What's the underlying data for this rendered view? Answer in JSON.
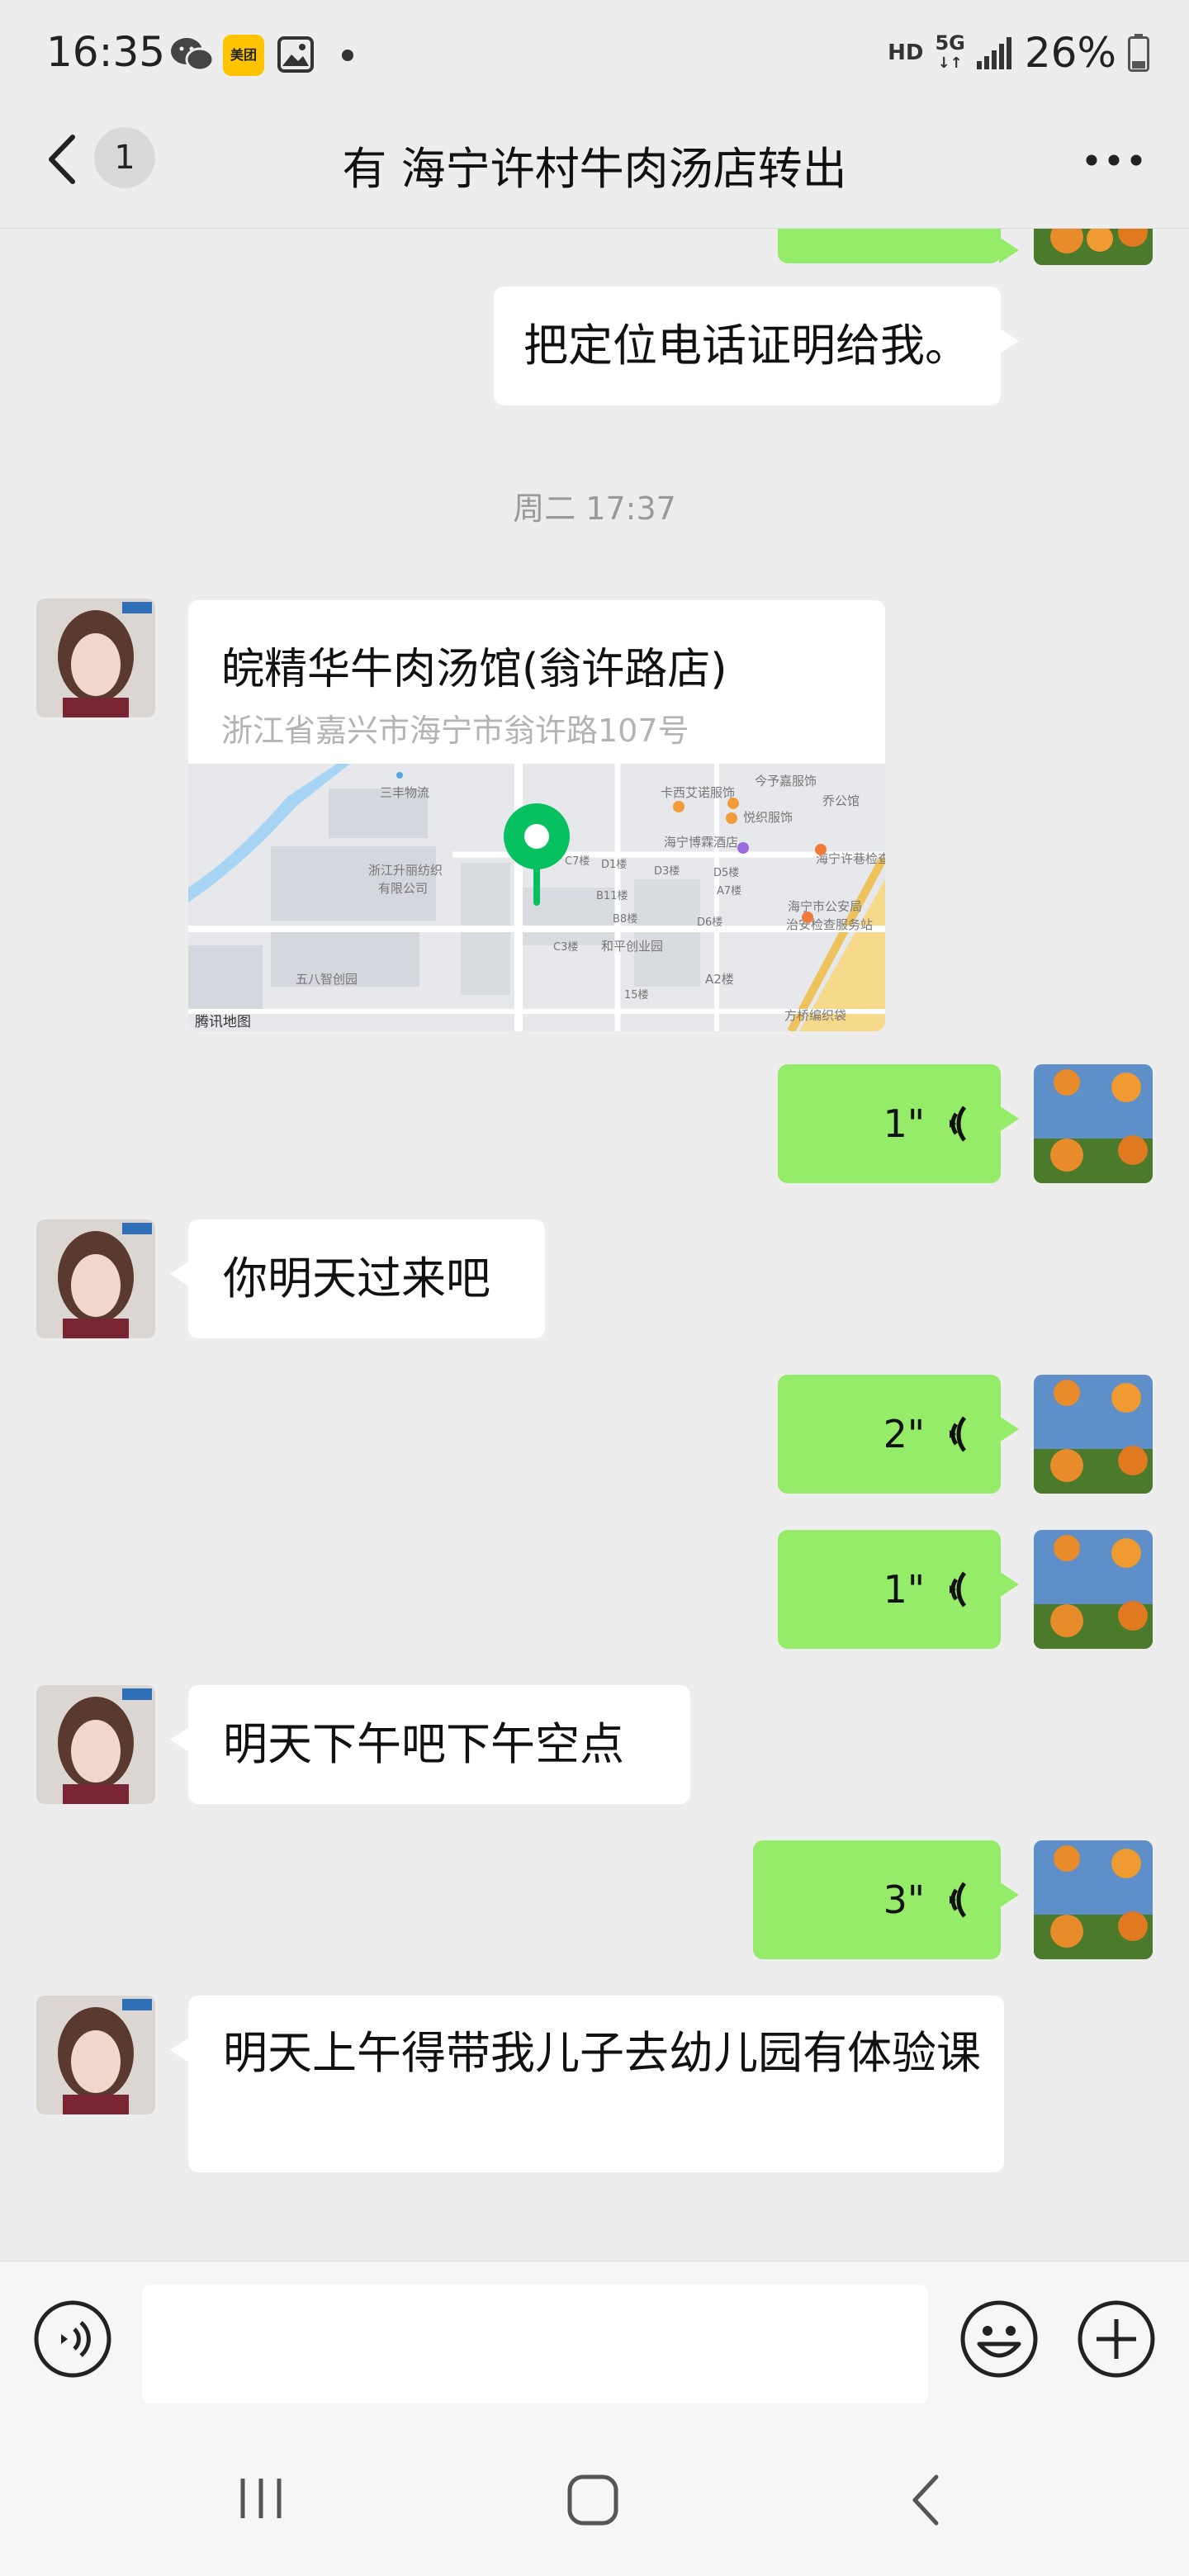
{
  "status_bar": {
    "time": "16:35",
    "app_icons": [
      "wechat-icon",
      "meituan-icon",
      "gallery-icon",
      "dot-icon"
    ],
    "meituan_label": "美团",
    "hd": "HD",
    "network": "5G",
    "battery": "26%"
  },
  "header": {
    "unread_count": "1",
    "title": "有 海宁许村牛肉汤店转出"
  },
  "messages": {
    "m1_text": "把定位电话证明给我。",
    "timestamp": "周二 17:37",
    "location": {
      "name": "皖精华牛肉汤馆(翁许路店)",
      "address": "浙江省嘉兴市海宁市翁许路107号",
      "map_watermark": "腾讯地图",
      "map_labels": [
        "三丰物流",
        "浙江升丽纺织",
        "有限公司",
        "五八智创园",
        "卡西艾诺服饰",
        "今予嘉服饰",
        "悦织服饰",
        "海宁博霖酒店",
        "乔公馆",
        "海宁许巷检查站",
        "海宁市公安局",
        "治安检查服务站",
        "和平创业园",
        "方桥编织袋",
        "A2楼",
        "D1楼",
        "D3楼",
        "D5楼",
        "B11楼",
        "B8楼",
        "C3楼",
        "C7楼",
        "A7楼",
        "D6楼",
        "15楼"
      ]
    },
    "v1_duration": "1\"",
    "m3_text": "你明天过来吧",
    "v2_duration": "2\"",
    "v3_duration": "1\"",
    "m5_text": "明天下午吧下午空点",
    "v4_duration": "3\"",
    "m7_text": "明天上午得带我儿子去幼儿园有体验课"
  },
  "input": {
    "value": ""
  },
  "colors": {
    "sent_bubble": "#95ec69",
    "received_bubble": "#ffffff",
    "background": "#ededed",
    "pin": "#07c160"
  }
}
